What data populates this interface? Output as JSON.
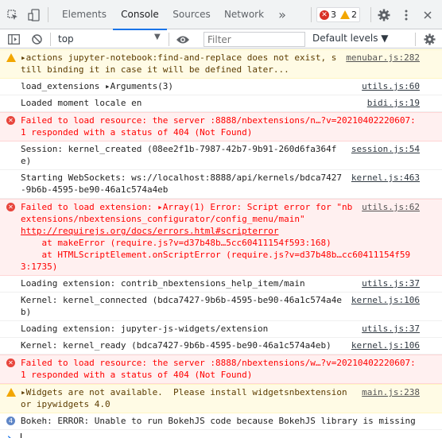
{
  "tabbar": {
    "tabs": [
      {
        "label": "Elements"
      },
      {
        "label": "Console"
      },
      {
        "label": "Sources"
      },
      {
        "label": "Network"
      }
    ],
    "more": "»",
    "error_count": "3",
    "warning_count": "2"
  },
  "toolbar": {
    "context": "top",
    "filter_placeholder": "Filter",
    "levels": "Default levels ▼"
  },
  "messages": [
    {
      "level": "warn",
      "text": "▸actions jupyter-notebook:find-and-replace does not exist, still binding it in case it will be defined later...",
      "source": "menubar.js:282"
    },
    {
      "level": "log",
      "text": "load_extensions ▸Arguments(3)",
      "source": "utils.js:60"
    },
    {
      "level": "log",
      "text": "Loaded moment locale en",
      "source": "bidi.js:19"
    },
    {
      "level": "err",
      "text": "Failed to load resource: the server :8888/nbextensions/n…?v=20210402220607:1 responded with a status of 404 (Not Found)",
      "source": ""
    },
    {
      "level": "log",
      "text": "Session: kernel_created (08ee2f1b-7987-42b7-9b91-260d6fa364fe)",
      "source": "session.js:54"
    },
    {
      "level": "log",
      "text": "Starting WebSockets: ws://localhost:8888/api/kernels/bdca7427-9b6b-4595-be90-46a1c574a4eb",
      "source": "kernel.js:463"
    },
    {
      "level": "err",
      "text": "Failed to load extension: ▸Array(1) Error: Script error for \"nbextensions/nbextensions_configurator/config_menu/main\"",
      "source": "utils.js:62",
      "extra": [
        "http://requirejs.org/docs/errors.html#scripterror",
        "    at makeError (require.js?v=d37b48b…5cc60411154f593:168)",
        "    at HTMLScriptElement.onScriptError (require.js?v=d37b48b…cc60411154f593:1735)"
      ]
    },
    {
      "level": "log",
      "text": "Loading extension: contrib_nbextensions_help_item/main",
      "source": "utils.js:37"
    },
    {
      "level": "log",
      "text": "Kernel: kernel_connected (bdca7427-9b6b-4595-be90-46a1c574a4eb)",
      "source": "kernel.js:106"
    },
    {
      "level": "log",
      "text": "Loading extension: jupyter-js-widgets/extension",
      "source": "utils.js:37"
    },
    {
      "level": "log",
      "text": "Kernel: kernel_ready (bdca7427-9b6b-4595-be90-46a1c574a4eb)",
      "source": "kernel.js:106"
    },
    {
      "level": "err",
      "text": "Failed to load resource: the server :8888/nbextensions/w…?v=20210402220607:1 responded with a status of 404 (Not Found)",
      "source": ""
    },
    {
      "level": "warn",
      "text": "▸Widgets are not available.  Please install widgetsnbextension or ipywidgets 4.0",
      "source": "main.js:238"
    },
    {
      "level": "count",
      "count": "4",
      "text": "Bokeh: ERROR: Unable to run BokehJS code because BokehJS library is missing",
      "source": ""
    }
  ],
  "prompt": {
    "chevron": "›"
  },
  "colors": {
    "accent": "#1a73e8",
    "error": "#ff0000",
    "warn_bg": "#fffbe5",
    "err_bg": "#fff0f0"
  }
}
